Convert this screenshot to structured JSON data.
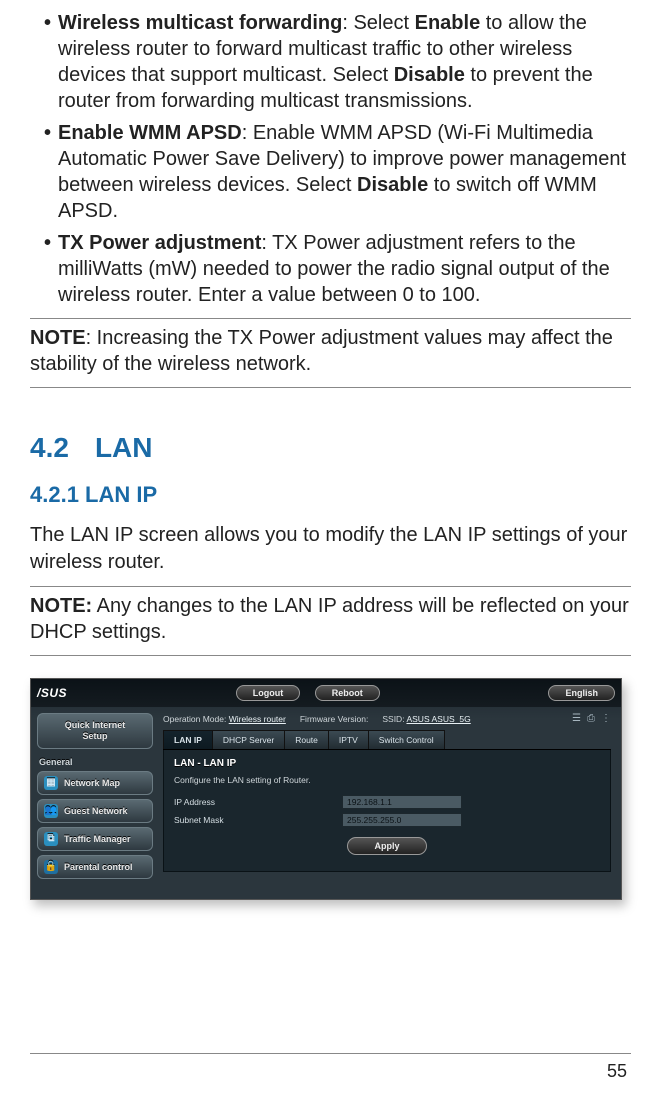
{
  "bullets": [
    {
      "title": "Wireless multicast forwarding",
      "body_pre": ":  Select ",
      "kw1": "Enable",
      "body_mid": " to allow the wireless router to forward multicast traffic to other wireless devices that support multicast. Select ",
      "kw2": "Disable",
      "body_post": " to prevent the router from forwarding multicast transmissions."
    },
    {
      "title": "Enable WMM APSD",
      "body_pre": ":  Enable WMM APSD (Wi-Fi Multimedia Automatic Power Save Delivery) to improve power management between wireless devices. Select ",
      "kw1": "Disable",
      "body_mid": " to switch off WMM APSD.",
      "kw2": "",
      "body_post": ""
    },
    {
      "title": "TX Power adjustment",
      "body_pre": ":  TX Power adjustment refers to the milliWatts (mW) needed to power the radio signal output of the wireless router. Enter a value between 0 to 100.",
      "kw1": "",
      "body_mid": "",
      "kw2": "",
      "body_post": ""
    }
  ],
  "note1_label": "NOTE",
  "note1_body": ":  Increasing the TX Power adjustment values may affect the stability of the wireless network.",
  "section_num": "4.2",
  "section_title": "LAN",
  "subsection": "4.2.1 LAN IP",
  "para1": "The LAN IP screen allows you to modify the LAN IP settings of your wireless router.",
  "note2_label": "NOTE:",
  "note2_body": "  Any changes to the LAN IP address will be reflected on your DHCP settings.",
  "router": {
    "logo": "/SUS",
    "logout": "Logout",
    "reboot": "Reboot",
    "lang": "English",
    "qis_line1": "Quick Internet",
    "qis_line2": "Setup",
    "side_general": "General",
    "nav": [
      {
        "icon": "▦",
        "label": "Network Map"
      },
      {
        "icon": "👥",
        "label": "Guest Network"
      },
      {
        "icon": "⧉",
        "label": "Traffic Manager"
      },
      {
        "icon": "🔒",
        "label": "Parental control"
      }
    ],
    "info_opmode_label": "Operation Mode:",
    "info_opmode_value": "Wireless router",
    "info_fw_label": "Firmware Version:",
    "info_ssid_label": "SSID:",
    "info_ssid_value": "ASUS ASUS_5G",
    "tabs": [
      "LAN IP",
      "DHCP Server",
      "Route",
      "IPTV",
      "Switch Control"
    ],
    "panel_title": "LAN - LAN IP",
    "panel_sub": "Configure the LAN setting of Router.",
    "rows": [
      {
        "label": "IP Address",
        "value": "192.168.1.1"
      },
      {
        "label": "Subnet Mask",
        "value": "255.255.255.0"
      }
    ],
    "apply": "Apply"
  },
  "page_number": "55"
}
